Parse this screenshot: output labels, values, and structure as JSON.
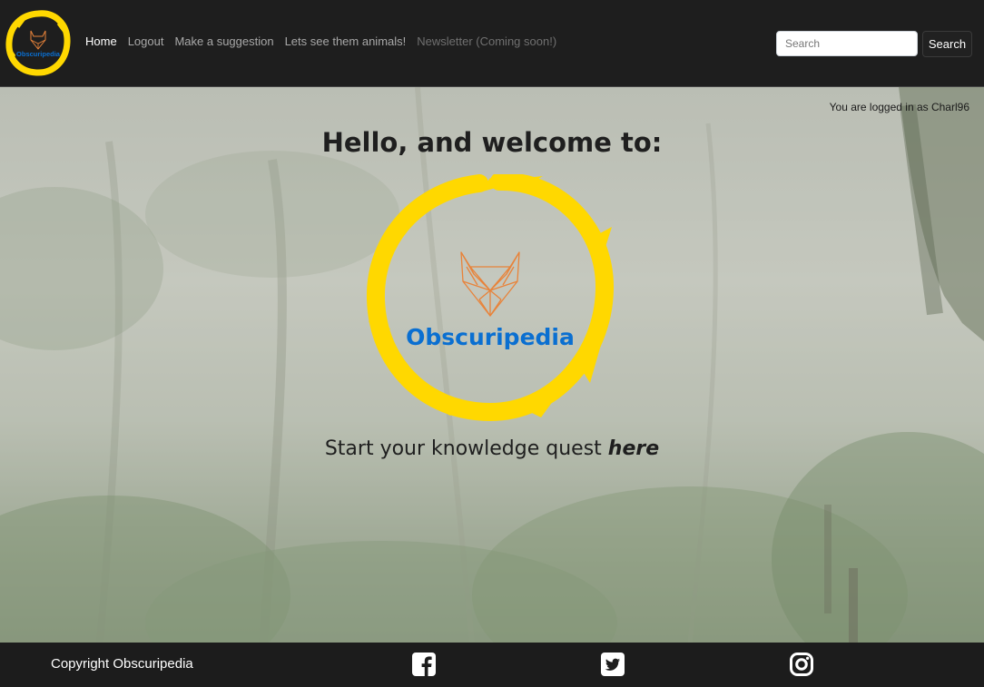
{
  "navbar": {
    "brand_name": "Obscuripedia",
    "links": [
      {
        "label": "Home"
      },
      {
        "label": "Logout"
      },
      {
        "label": "Make a suggestion"
      },
      {
        "label": "Lets see them animals!"
      },
      {
        "label": "Newsletter (Coming soon!)"
      }
    ],
    "search": {
      "placeholder": "Search",
      "button_label": "Search"
    }
  },
  "main": {
    "logged_in_text": "You are logged in as Charl96",
    "welcome_heading": "Hello, and welcome to:",
    "logo_text": "Obscuripedia",
    "tagline_prefix": "Start your knowledge quest ",
    "tagline_link": "here"
  },
  "footer": {
    "copyright": "Copyright Obscuripedia",
    "social_icons": [
      "facebook-icon",
      "twitter-icon",
      "instagram-icon"
    ]
  },
  "colors": {
    "brand_yellow": "#ffd800",
    "brand_blue": "#0a6fd1",
    "fox_orange": "#e8833a",
    "navbar_bg": "#1e1e1e"
  }
}
